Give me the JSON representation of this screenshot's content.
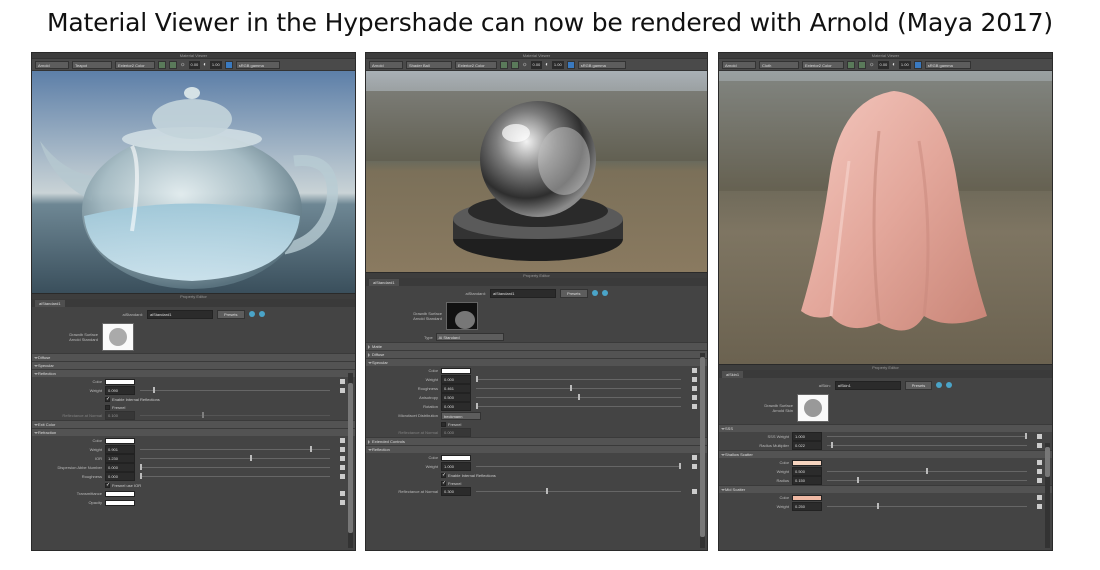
{
  "title": "Material Viewer in the Hypershade can now be rendered with Arnold (Maya 2017)",
  "panels": [
    {
      "viewer_title": "Material Viewer",
      "renderer": "Arnold",
      "geometry": "Teapot",
      "env": "Exterior2 Color",
      "exposure": "0.00",
      "gamma": "1.00",
      "view_transform": "sRGB gamma",
      "pe_title": "Property Editor",
      "tab": "aiStandard1",
      "shader_label": "aiStandard:",
      "shader_value": "aiStandard1",
      "presets": "Presets",
      "swatch_label": "Drawdb Surface Arnold Standard",
      "sections": [
        "Diffuse",
        "Specular",
        "Reflection",
        "Exit Color",
        "Refraction"
      ],
      "reflection": {
        "color_label": "Color",
        "weight_label": "Weight",
        "weight": "0.090",
        "cb1": "Enable Internal Reflections",
        "cb2": "Fresnel",
        "normal_label": "Reflectance at Normal",
        "normal": "0.100"
      },
      "refraction": {
        "color_label": "Color",
        "weight_label": "Weight",
        "weight": "0.901",
        "ior_label": "IOR",
        "ior": "1.230",
        "disp_label": "Dispersion Abbe Number",
        "disp": "0.000",
        "rough_label": "Roughness",
        "rough": "0.000",
        "cb": "Fresnel use IOR",
        "trans_label": "Transmittance",
        "opac_label": "Opacity"
      }
    },
    {
      "viewer_title": "Material Viewer",
      "renderer": "Arnold",
      "geometry": "Shader Ball",
      "env": "Exterior2 Color",
      "exposure": "0.00",
      "gamma": "1.00",
      "view_transform": "sRGB gamma",
      "pe_title": "Property Editor",
      "tab": "aiStandard1",
      "shader_label": "aiStandard:",
      "shader_value": "aiStandard1",
      "presets": "Presets",
      "swatch_label": "Drawdb Surface Arnold Standard",
      "type_label": "Type",
      "type_value": "Ai Standard",
      "sections": [
        "Matte",
        "Diffuse",
        "Specular"
      ],
      "specular": {
        "color_label": "Color",
        "weight_label": "Weight",
        "weight": "0.000",
        "rough_label": "Roughness",
        "rough": "0.461",
        "aniso_label": "Anisotropy",
        "aniso": "0.500",
        "rot_label": "Rotation",
        "rot": "0.000",
        "md_label": "Microfacet Distribution",
        "md_value": "beckmann",
        "cb": "Fresnel",
        "normal_label": "Reflectance at Normal",
        "normal": "0.000"
      },
      "sections2": [
        "Extended Controls",
        "Reflection"
      ],
      "reflection": {
        "color_label": "Color",
        "weight_label": "Weight",
        "weight": "1.000",
        "cb1": "Enable Internal Reflections",
        "cb2": "Fresnel",
        "normal_label": "Reflectance at Normal",
        "normal": "0.300"
      }
    },
    {
      "viewer_title": "Material Viewer",
      "renderer": "Arnold",
      "geometry": "Cloth",
      "env": "Exterior2 Color",
      "exposure": "0.00",
      "gamma": "1.00",
      "view_transform": "sRGB gamma",
      "pe_title": "Property Editor",
      "tab": "aiSkin1",
      "shader_label": "aiSkin:",
      "shader_value": "aiSkin1",
      "presets": "Presets",
      "swatch_label": "Drawdb Surface Arnold Skin",
      "sections": [
        "SSS",
        "Shallow Scatter",
        "Mid Scatter"
      ],
      "sss": {
        "w_label": "SSS Weight",
        "w": "1.000",
        "r_label": "Radius Multiplier",
        "r": "0.022"
      },
      "shallow": {
        "color_label": "Color",
        "weight_label": "Weight",
        "weight": "0.500",
        "radius_label": "Radius",
        "radius": "0.150"
      },
      "mid": {
        "color_label": "Color",
        "weight_label": "Weight",
        "weight": "0.250"
      }
    }
  ],
  "colors": {
    "panel_bg": "#444444",
    "accent": "#4aa4c8"
  }
}
